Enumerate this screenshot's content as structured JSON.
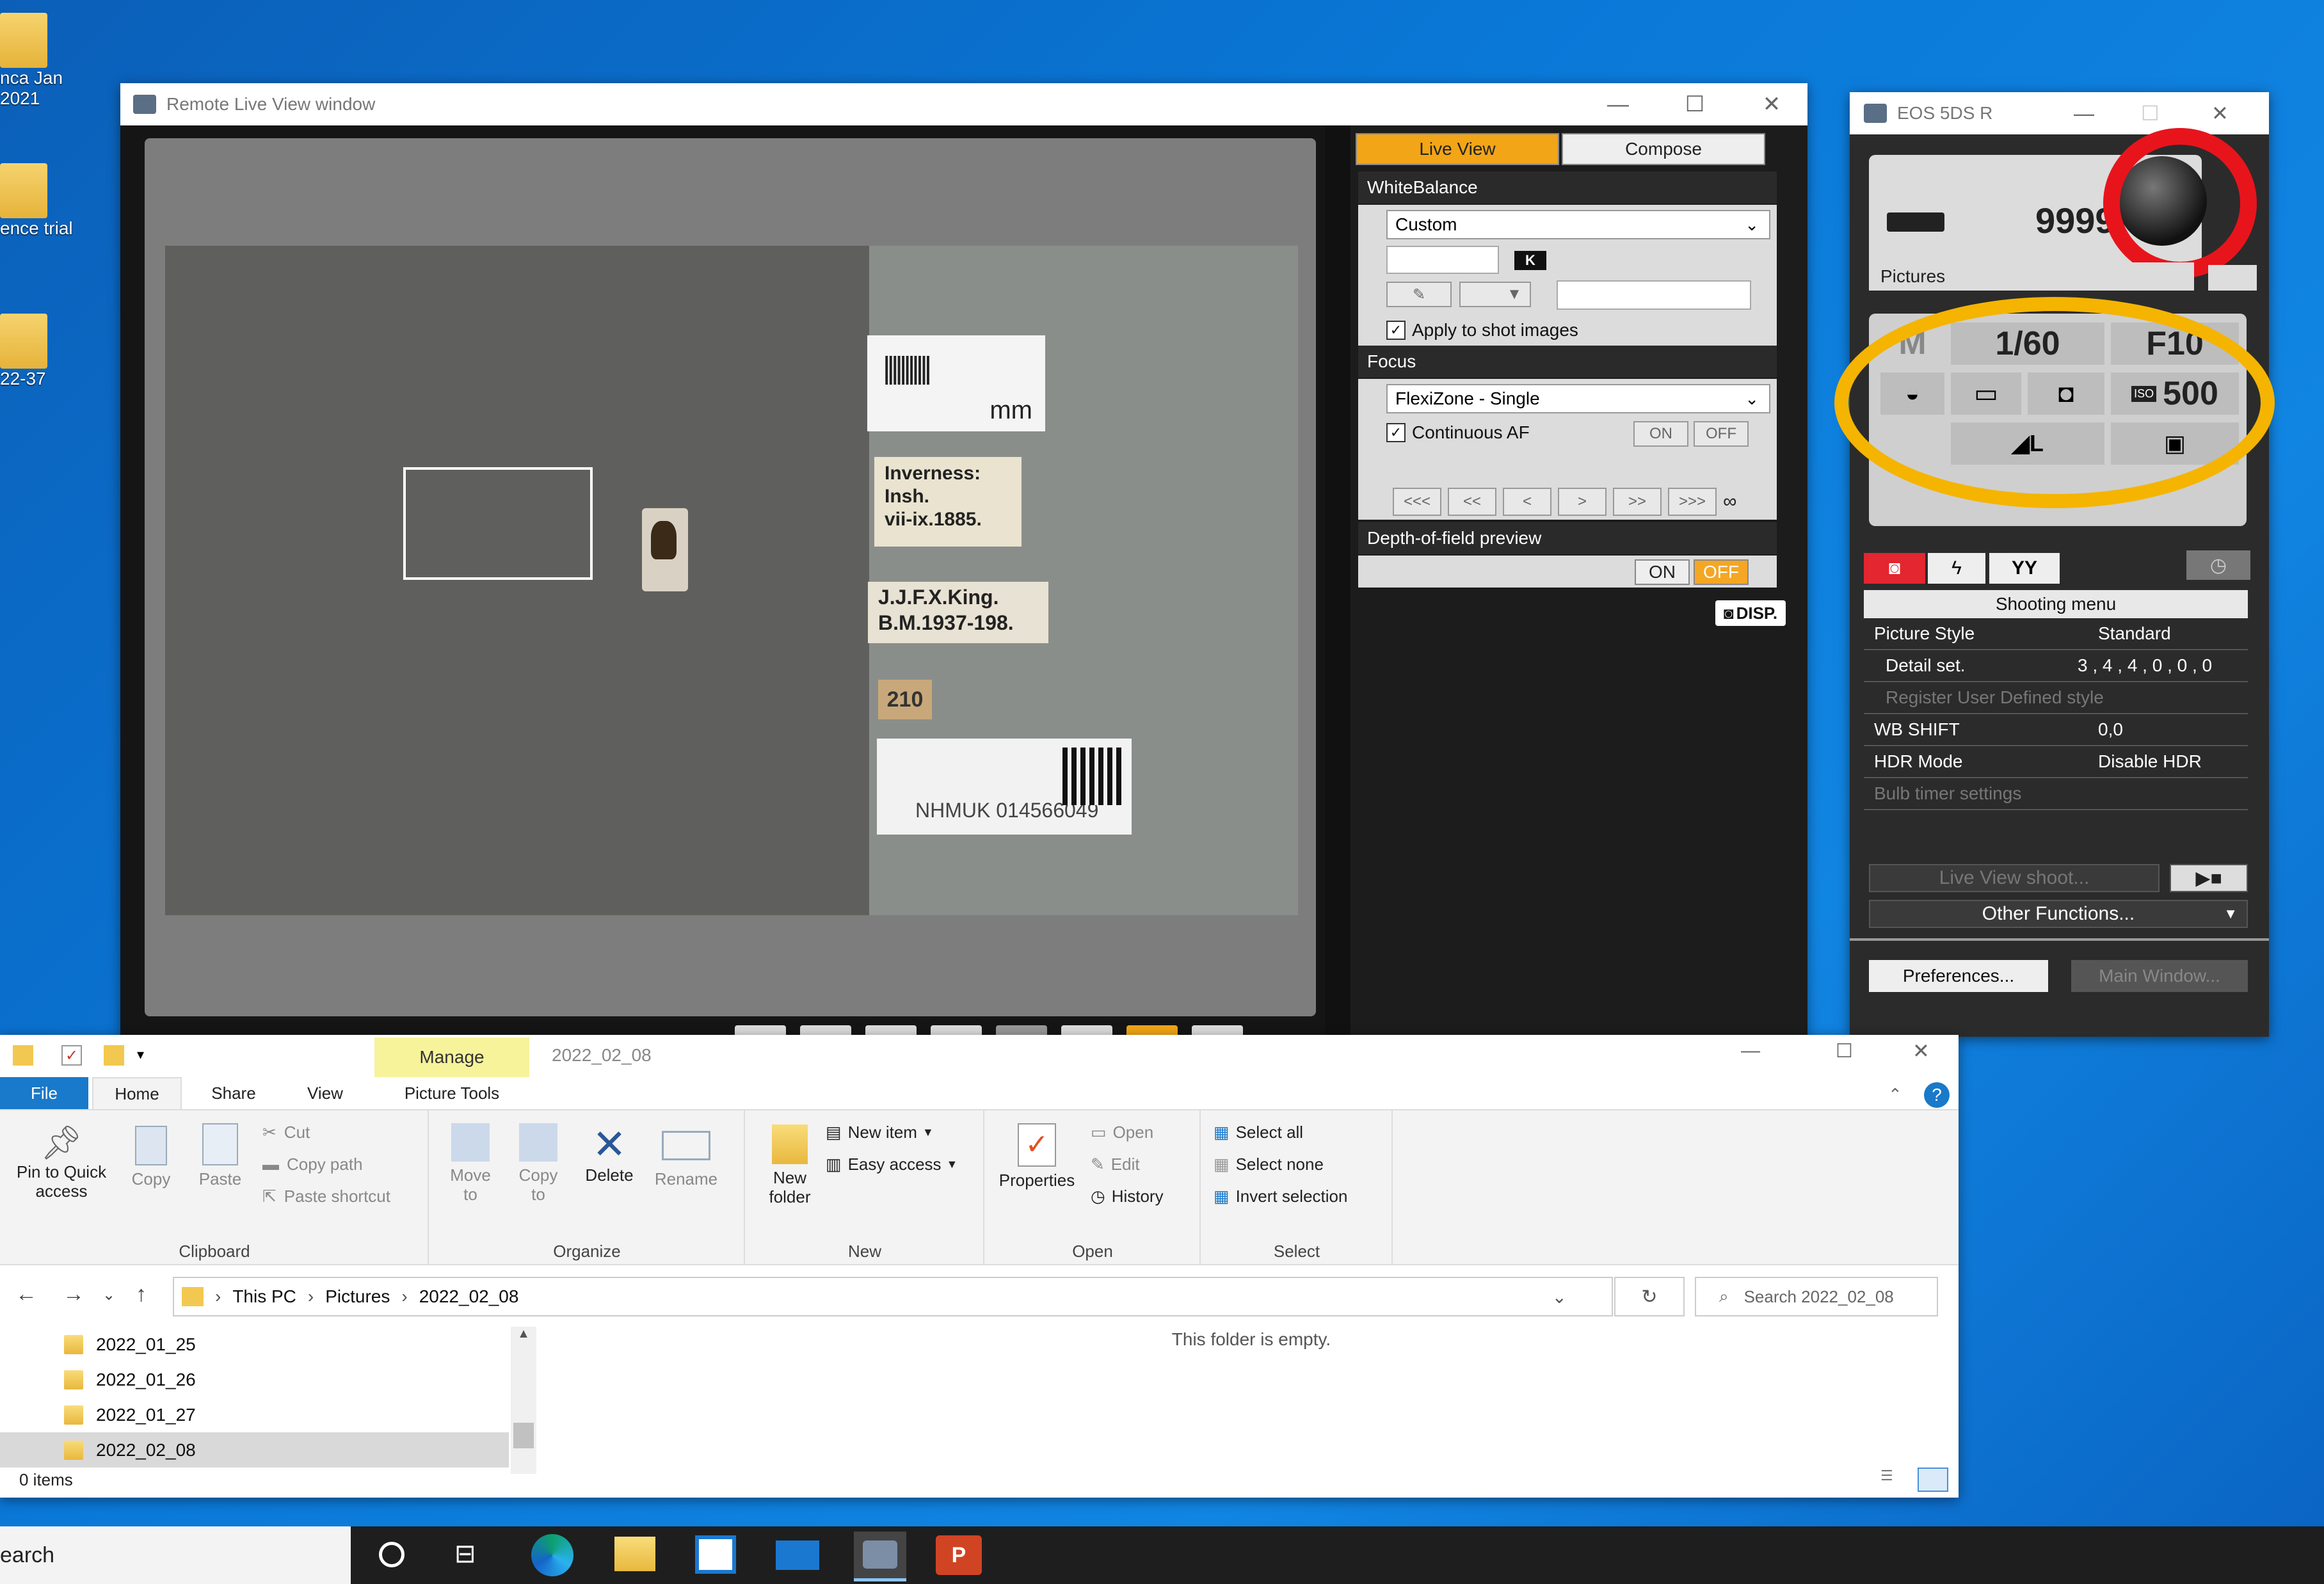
{
  "desktop": {
    "icons": [
      {
        "label": "nca Jan\n2021"
      },
      {
        "label": "ence trial"
      },
      {
        "label": "22-37"
      }
    ]
  },
  "liveview": {
    "title": "Remote Live View window",
    "tabs": [
      "Live View",
      "Compose"
    ],
    "wb": {
      "header": "WhiteBalance",
      "mode": "Custom",
      "kelvin_badge": "K",
      "apply_label": "Apply to shot images"
    },
    "focus": {
      "header": "Focus",
      "mode": "FlexiZone - Single",
      "continuous_label": "Continuous AF",
      "on": "ON",
      "off": "OFF",
      "steps": [
        "<<<",
        "<<",
        "<",
        ">",
        ">>",
        ">>>"
      ],
      "infinity": "∞"
    },
    "dof": {
      "header": "Depth-of-field preview",
      "on": "ON",
      "off": "OFF"
    },
    "disp_label": "DISP.",
    "specimen": {
      "label1": "Inverness:\nInsh.\nvii-ix.1885.",
      "label2": "J.J.F.X.King.\nB.M.1937-198.",
      "label3": "210",
      "label4": "NHMUK 014566049",
      "scale_unit": "mm"
    }
  },
  "eos": {
    "title": "EOS 5DS R",
    "shots_remaining": "9999",
    "save_folder": "Pictures",
    "mode": "M",
    "shutter": "1/60",
    "aperture": "F10",
    "iso_badge": "ISO",
    "iso": "500",
    "shooting_menu_title": "Shooting menu",
    "menu": [
      {
        "label": "Picture Style",
        "value": "Standard"
      },
      {
        "label": "Detail set.",
        "value": "3 , 4 , 4 , 0 , 0 , 0"
      },
      {
        "label": "Register User Defined style",
        "value": ""
      },
      {
        "label": "WB SHIFT",
        "value": "0,0"
      },
      {
        "label": "HDR Mode",
        "value": "Disable HDR"
      },
      {
        "label": "Bulb timer settings",
        "value": ""
      }
    ],
    "live_view_shoot": "Live View shoot...",
    "other_functions": "Other Functions...",
    "preferences": "Preferences...",
    "main_window": "Main Window...",
    "colors": {
      "highlight_red": "#e8141c",
      "highlight_orange": "#f5b400"
    }
  },
  "explorer": {
    "title": "2022_02_08",
    "context_tab": "Manage",
    "tabs": [
      "File",
      "Home",
      "Share",
      "View",
      "Picture Tools"
    ],
    "clipboard": {
      "pin": "Pin to Quick\naccess",
      "copy": "Copy",
      "paste": "Paste",
      "cut": "Cut",
      "copy_path": "Copy path",
      "paste_shortcut": "Paste shortcut",
      "group": "Clipboard"
    },
    "organize": {
      "move_to": "Move\nto",
      "copy_to": "Copy\nto",
      "delete": "Delete",
      "rename": "Rename",
      "group": "Organize"
    },
    "new": {
      "new_folder": "New\nfolder",
      "new_item": "New item",
      "easy_access": "Easy access",
      "group": "New"
    },
    "open": {
      "properties": "Properties",
      "open": "Open",
      "edit": "Edit",
      "history": "History",
      "group": "Open"
    },
    "select": {
      "select_all": "Select all",
      "select_none": "Select none",
      "invert": "Invert selection",
      "group": "Select"
    },
    "breadcrumb": [
      "This PC",
      "Pictures",
      "2022_02_08"
    ],
    "search_placeholder": "Search 2022_02_08",
    "tree": [
      "2022_01_25",
      "2022_01_26",
      "2022_01_27",
      "2022_02_08"
    ],
    "empty_text": "This folder is empty.",
    "status": "0 items"
  },
  "taskbar": {
    "search_text": "earch"
  }
}
